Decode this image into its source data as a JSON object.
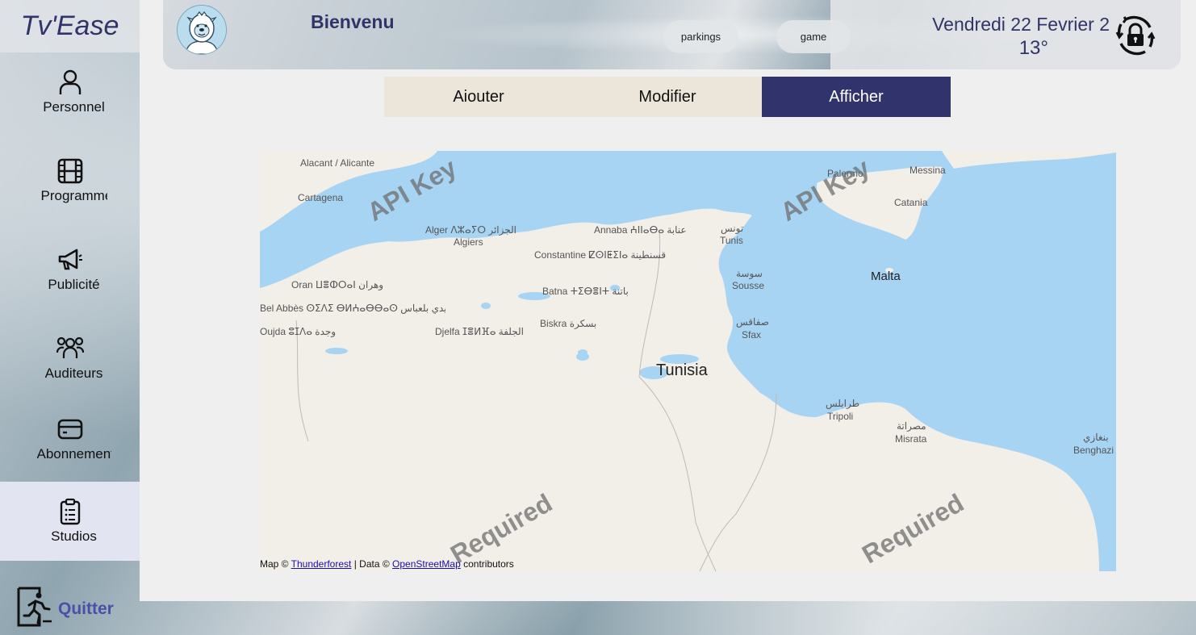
{
  "app": {
    "logo": "Tv'Ease"
  },
  "sidebar": {
    "items": [
      {
        "label": "Personnel",
        "icon": "person-icon"
      },
      {
        "label": "Programmes",
        "icon": "film-icon"
      },
      {
        "label": "Publicité",
        "icon": "megaphone-icon"
      },
      {
        "label": "Auditeurs",
        "icon": "users-icon"
      },
      {
        "label": "Abonnements",
        "icon": "card-icon"
      },
      {
        "label": "Studios",
        "icon": "clipboard-icon"
      }
    ],
    "quit_label": "Quitter"
  },
  "header": {
    "welcome": "Bienvenu",
    "pills": [
      "parkings",
      "game"
    ],
    "date": "Vendredi 22  Fevrier 2",
    "temperature": "13°"
  },
  "tabs": [
    {
      "label": "Aiouter",
      "active": false
    },
    {
      "label": "Modifier",
      "active": false
    },
    {
      "label": "Afficher",
      "active": true
    }
  ],
  "map": {
    "places": [
      "Alacant / Alicante",
      "Cartagena",
      "Palermo",
      "Messina",
      "Catania",
      "Alger ⴷⵣⴰⵢⵔ الجزائر",
      "Algiers",
      "Annaba ⵄⵏⵏⴰⴱⴰ عنابة",
      "تونس",
      "Tunis",
      "Constantine ⵇⵙⵏⵟⵉⵏⴰ قسنطينة",
      "Malta",
      "Oran ⵡⴻⵀⵔⴰⵏ وهران",
      "سوسة",
      "Sousse",
      "Batna ⵜⵉⴱⴻⵏⵜ باتنة",
      "Bel Abbès ⵙⵉⴷⵉ ⴱⵍⵄⴰⴱⴱⴰⵙ سيدي بلعباس",
      "صفاقس",
      "Sfax",
      "Biskra  بسكرة",
      "Oujda ⵓⵊⴷⴰ وجدة",
      "Djelfa ⵊⴻⵍⴼⴰ الجلفة",
      "Tunisia",
      "طرابلس",
      "Tripoli",
      "مصراتة",
      "Misrata",
      "بنغازي",
      "Benghazi"
    ],
    "watermarks": [
      "API Key",
      "API Key",
      "Required",
      "Required"
    ],
    "attribution": {
      "prefix": "Map ©",
      "provider": "Thunderforest",
      "middle": "| Data ©",
      "data": "OpenStreetMap",
      "suffix": "contributors"
    }
  },
  "colors": {
    "brand": "#303468",
    "active_tab": "#31346c",
    "tab_bg": "#ece6da",
    "sea": "#a8d4f4",
    "land": "#f2efe9"
  }
}
